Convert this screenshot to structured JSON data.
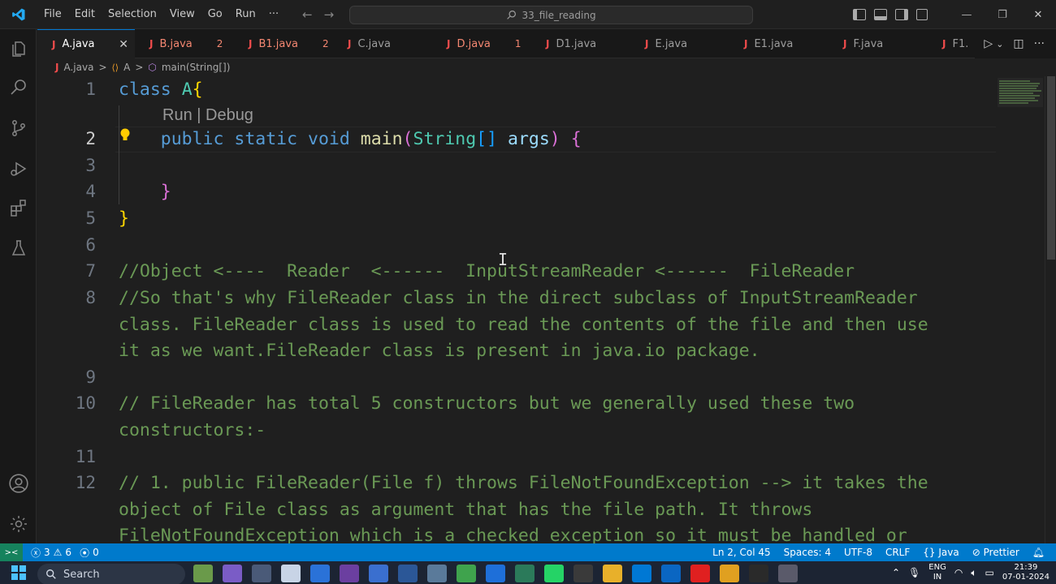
{
  "titlebar": {
    "menu": [
      "File",
      "Edit",
      "Selection",
      "View",
      "Go",
      "Run",
      "···"
    ],
    "search_text": "33_file_reading",
    "back_arrow": "←",
    "forward_arrow": "→",
    "minimize": "—",
    "restore": "❐",
    "close": "✕"
  },
  "activity_icons": [
    "explorer-icon",
    "search-icon",
    "source-control-icon",
    "run-debug-icon",
    "extensions-icon",
    "testing-icon",
    "account-icon",
    "settings-gear-icon"
  ],
  "tabs": [
    {
      "label": "A.java",
      "count": "",
      "active": true,
      "close": "✕",
      "width": 120
    },
    {
      "label": "B.java",
      "count": "2",
      "active": false,
      "width": 122
    },
    {
      "label": "B1.java",
      "count": "2",
      "active": false,
      "width": 122
    },
    {
      "label": "C.java",
      "count": "",
      "active": false,
      "width": 122
    },
    {
      "label": "D.java",
      "count": "1",
      "active": false,
      "width": 122
    },
    {
      "label": "D1.java",
      "count": "",
      "active": false,
      "width": 122
    },
    {
      "label": "E.java",
      "count": "",
      "active": false,
      "width": 122
    },
    {
      "label": "E1.java",
      "count": "",
      "active": false,
      "width": 122
    },
    {
      "label": "F.java",
      "count": "",
      "active": false,
      "width": 122
    },
    {
      "label": "F1.",
      "count": "",
      "active": false,
      "width": 60
    }
  ],
  "tab_actions": {
    "run": "▷",
    "chevron": "⌄",
    "split": "◫",
    "more": "···"
  },
  "breadcrumb": {
    "file": "A.java",
    "class": "A",
    "method": "main(String[])",
    "sep": ">"
  },
  "editor": {
    "codelens": "Run | Debug",
    "line_numbers": [
      "1",
      "2",
      "3",
      "4",
      "5",
      "6",
      "7",
      "8",
      "9",
      "10",
      "11",
      "12"
    ],
    "lines": {
      "l1_kw": "class",
      "l1_cls": "A",
      "l1_br": "{",
      "l2_public": "public",
      "l2_static": "static",
      "l2_void": "void",
      "l2_main": "main",
      "l2_paren_open": "(",
      "l2_string": "String",
      "l2_arr": "[]",
      "l2_args": "args",
      "l2_paren_close": ")",
      "l2_brace": "{",
      "l4_brace": "}",
      "l5_brace": "}",
      "l7": "//Object <----  Reader  <------  InputStreamReader <------  FileReader",
      "l8a": "//So that's why FileReader class in the direct subclass of InputStreamReader",
      "l8b": "class. FileReader class is used to read the contents of the file and then use",
      "l8c": "it as we want.FileReader class is present in java.io package.",
      "l10a": "// FileReader has total 5 constructors but we generally used these two",
      "l10b": "constructors:-",
      "l12a": "// 1. public FileReader(File f) throws FileNotFoundException --> it takes the",
      "l12b": "object of File class as argument that has the file path. It throws",
      "l12c": "FileNotFoundException which is a checked exception so it must be handled or"
    },
    "cursor_glyph": "I"
  },
  "statusbar": {
    "remote": "><",
    "errors": "3",
    "warnings": "6",
    "ports": "0",
    "position": "Ln 2, Col 45",
    "spaces": "Spaces: 4",
    "encoding": "UTF-8",
    "eol": "CRLF",
    "language": "Java",
    "formatter": "Prettier"
  },
  "taskbar": {
    "search_placeholder": "Search",
    "lang_top": "ENG",
    "lang_bottom": "IN",
    "time": "21:39",
    "date": "07-01-2024",
    "app_colors": [
      "#6a9a4a",
      "#7a5cc6",
      "#4a5a78",
      "#c8d4e6",
      "#2a72d8",
      "#6b3fa0",
      "#3a6fcf",
      "#2b5797",
      "#5a7a9a",
      "#3fa34d",
      "#1e6fd9",
      "#2b7a5a",
      "#25d366",
      "#3a3a3a",
      "#e8b02a",
      "#0078d4",
      "#0a66c2",
      "#e02020",
      "#e0a020",
      "#2a2a2a",
      "#5a5a6a"
    ]
  },
  "colors": {
    "accent": "#007acc",
    "keyword": "#569cd6",
    "class": "#4ec9b0",
    "function": "#dcdcaa",
    "variable": "#9cdcfe",
    "comment": "#6a9955",
    "bracket_gold": "#ffd700",
    "bracket_purple": "#da70d6",
    "error_tab": "#f48771"
  }
}
